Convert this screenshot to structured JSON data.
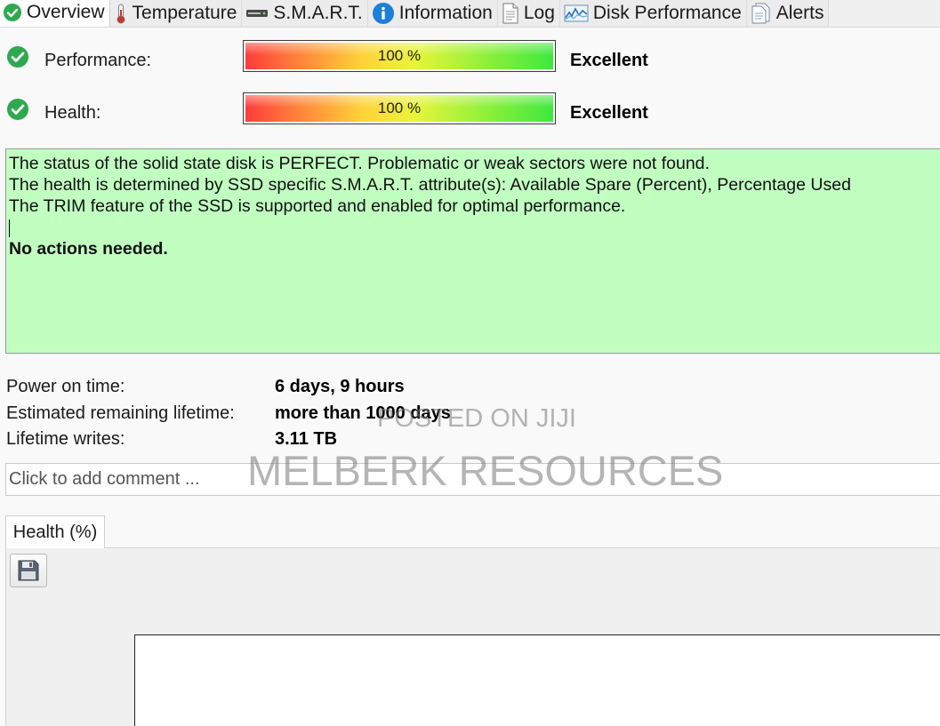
{
  "tabs": [
    {
      "label": "Overview",
      "icon": "check-circle-icon",
      "active": true
    },
    {
      "label": "Temperature",
      "icon": "thermometer-icon",
      "active": false
    },
    {
      "label": "S.M.A.R.T.",
      "icon": "drive-icon",
      "active": false
    },
    {
      "label": "Information",
      "icon": "info-icon",
      "active": false
    },
    {
      "label": "Log",
      "icon": "document-icon",
      "active": false
    },
    {
      "label": "Disk Performance",
      "icon": "performance-graph-icon",
      "active": false
    },
    {
      "label": "Alerts",
      "icon": "alerts-icon",
      "active": false
    }
  ],
  "gauges": {
    "performance": {
      "label": "Performance:",
      "value_text": "100 %",
      "value": 100,
      "rating": "Excellent"
    },
    "health": {
      "label": "Health:",
      "value_text": "100 %",
      "value": 100,
      "rating": "Excellent"
    }
  },
  "status": {
    "lines": [
      "The status of the solid state disk is PERFECT. Problematic or weak sectors were not found.",
      "The health is determined by SSD specific S.M.A.R.T. attribute(s):  Available Spare (Percent), Percentage Used",
      "The TRIM feature of the SSD is supported and enabled for optimal performance."
    ],
    "action": "No actions needed.",
    "background": "#c1ffc1"
  },
  "info": {
    "power_on_label": "Power on time:",
    "power_on_value": "6 days, 9 hours",
    "lifetime_label": "Estimated remaining lifetime:",
    "lifetime_value": "more than 1000 days",
    "writes_label": "Lifetime writes:",
    "writes_value": "3.11 TB"
  },
  "comment": {
    "placeholder": "Click to add comment ...",
    "value": ""
  },
  "lower": {
    "subtab_label": "Health (%)",
    "save_icon": "floppy-disk-icon"
  },
  "watermarks": {
    "top": "POSTED ON JIJI",
    "bottom": "MELBERK RESOURCES"
  },
  "colors": {
    "ok_green": "#2fa84f",
    "status_bg": "#c1ffc1"
  }
}
